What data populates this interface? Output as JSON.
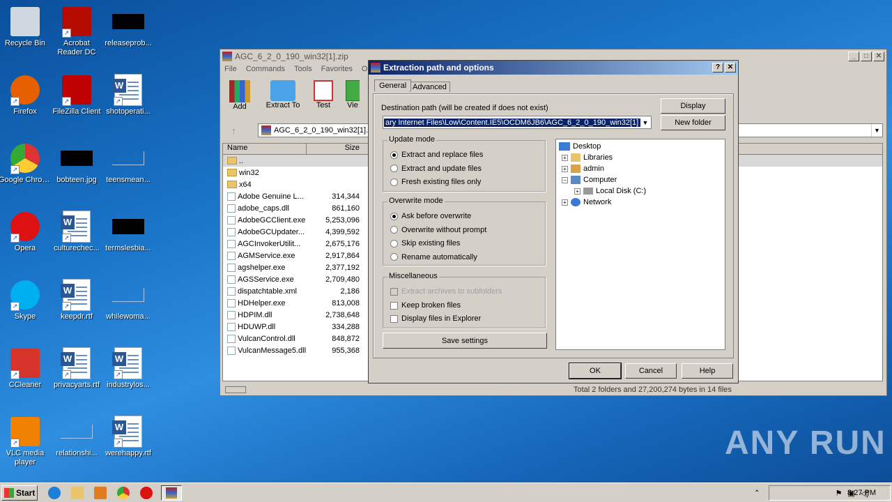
{
  "desktop": {
    "icons": [
      {
        "label": "Recycle Bin"
      },
      {
        "label": "Acrobat Reader DC"
      },
      {
        "label": "releaseprob..."
      },
      {
        "label": "Firefox"
      },
      {
        "label": "FileZilla Client"
      },
      {
        "label": "shotoperati..."
      },
      {
        "label": "Google Chrome"
      },
      {
        "label": "bobteen.jpg"
      },
      {
        "label": "teensmean..."
      },
      {
        "label": "Opera"
      },
      {
        "label": "culturechec..."
      },
      {
        "label": "termslesbia..."
      },
      {
        "label": "Skype"
      },
      {
        "label": "keepdr.rtf"
      },
      {
        "label": "whilewoma..."
      },
      {
        "label": "CCleaner"
      },
      {
        "label": "privacyarts.rtf"
      },
      {
        "label": "industrylos..."
      },
      {
        "label": "VLC media player"
      },
      {
        "label": "relationshi..."
      },
      {
        "label": "werehappy.rtf"
      }
    ]
  },
  "winrar": {
    "title": "AGC_6_2_0_190_win32[1].zip",
    "menu": [
      "File",
      "Commands",
      "Tools",
      "Favorites",
      "Opt"
    ],
    "toolbar": [
      "Add",
      "Extract To",
      "Test",
      "Vie"
    ],
    "path": "AGC_6_2_0_190_win32[1].",
    "columns": {
      "name": "Name",
      "size": "Size"
    },
    "files": [
      {
        "name": "..",
        "size": "",
        "type": "folder"
      },
      {
        "name": "win32",
        "size": "",
        "type": "folder"
      },
      {
        "name": "x64",
        "size": "",
        "type": "folder"
      },
      {
        "name": "Adobe Genuine L...",
        "size": "314,344",
        "type": "file"
      },
      {
        "name": "adobe_caps.dll",
        "size": "861,160",
        "type": "file"
      },
      {
        "name": "AdobeGCClient.exe",
        "size": "5,253,096",
        "type": "file"
      },
      {
        "name": "AdobeGCUpdater...",
        "size": "4,399,592",
        "type": "file"
      },
      {
        "name": "AGCInvokerUtilit...",
        "size": "2,675,176",
        "type": "file"
      },
      {
        "name": "AGMService.exe",
        "size": "2,917,864",
        "type": "file"
      },
      {
        "name": "agshelper.exe",
        "size": "2,377,192",
        "type": "file"
      },
      {
        "name": "AGSService.exe",
        "size": "2,709,480",
        "type": "file"
      },
      {
        "name": "dispatchtable.xml",
        "size": "2,186",
        "type": "file"
      },
      {
        "name": "HDHelper.exe",
        "size": "813,008",
        "type": "file"
      },
      {
        "name": "HDPIM.dll",
        "size": "2,738,648",
        "type": "file"
      },
      {
        "name": "HDUWP.dll",
        "size": "334,288",
        "type": "file"
      },
      {
        "name": "VulcanControl.dll",
        "size": "848,872",
        "type": "file"
      },
      {
        "name": "VulcanMessage5.dll",
        "size": "955,368",
        "type": "file"
      }
    ],
    "status": "Total 2 folders and 27,200,274 bytes in 14 files"
  },
  "dialog": {
    "title": "Extraction path and options",
    "help": "?",
    "close": "✕",
    "tabs": [
      "General",
      "Advanced"
    ],
    "dest_label": "Destination path (will be created if does not exist)",
    "dest_value": "ary Internet Files\\Low\\Content.IE5\\OCDM6JB6\\AGC_6_2_0_190_win32[1]",
    "display_btn": "Display",
    "newfolder_btn": "New folder",
    "update_mode": {
      "label": "Update mode",
      "options": [
        "Extract and replace files",
        "Extract and update files",
        "Fresh existing files only"
      ],
      "selected": 0
    },
    "overwrite_mode": {
      "label": "Overwrite mode",
      "options": [
        "Ask before overwrite",
        "Overwrite without prompt",
        "Skip existing files",
        "Rename automatically"
      ],
      "selected": 0
    },
    "misc": {
      "label": "Miscellaneous",
      "options": [
        "Extract archives to subfolders",
        "Keep broken files",
        "Display files in Explorer"
      ]
    },
    "save_btn": "Save settings",
    "tree": [
      "Desktop",
      "Libraries",
      "admin",
      "Computer",
      "Local Disk (C:)",
      "Network"
    ],
    "ok": "OK",
    "cancel": "Cancel",
    "helpbtn": "Help"
  },
  "taskbar": {
    "start": "Start",
    "clock": "8:27 PM"
  },
  "watermark": "ANY RUN"
}
